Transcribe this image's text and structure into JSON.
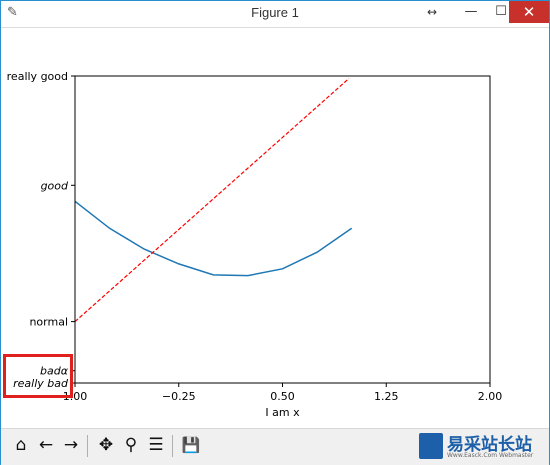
{
  "window": {
    "title": "Figure 1",
    "icon": "feather-icon",
    "buttons": {
      "resize": "↔",
      "minimize": "—",
      "maximize": "☐",
      "close": "✕"
    }
  },
  "toolbar": {
    "items": [
      {
        "name": "home-icon",
        "glyph": "⌂"
      },
      {
        "name": "back-arrow-icon",
        "glyph": "←"
      },
      {
        "name": "forward-arrow-icon",
        "glyph": "→"
      },
      {
        "name": "pan-icon",
        "glyph": "✥"
      },
      {
        "name": "zoom-icon",
        "glyph": "⚲"
      },
      {
        "name": "configure-subplots-icon",
        "glyph": "☰"
      },
      {
        "name": "save-icon",
        "glyph": "💾"
      }
    ]
  },
  "brand": {
    "name": "易采站长站",
    "url": "Www.Easck.Com Webmaster"
  },
  "chart_data": {
    "type": "line",
    "xlabel": "I am x",
    "xlim": [
      -1.0,
      2.0
    ],
    "ylim": [
      -2.0,
      3.0
    ],
    "xticks": [
      {
        "value": -1.0,
        "label": "1.00"
      },
      {
        "value": -0.25,
        "label": "−0.25"
      },
      {
        "value": 0.5,
        "label": "0.50"
      },
      {
        "value": 1.25,
        "label": "1.25"
      },
      {
        "value": 2.0,
        "label": "2.00"
      }
    ],
    "yticks": [
      {
        "value": -2.0,
        "label": "really bad",
        "style": "italic"
      },
      {
        "value": -1.8,
        "label": "badα",
        "style": "italic"
      },
      {
        "value": -1.0,
        "label": "normal",
        "style": "normal"
      },
      {
        "value": 1.22,
        "label": "good",
        "style": "italic"
      },
      {
        "value": 3.0,
        "label": "really good",
        "style": "normal"
      }
    ],
    "series": [
      {
        "style": "solid",
        "color": "#1f77b4",
        "x": [
          -1.0,
          -0.75,
          -0.5,
          -0.25,
          0.0,
          0.25,
          0.5,
          0.75,
          1.0
        ],
        "y": [
          0.96,
          0.52,
          0.18,
          -0.06,
          -0.24,
          -0.25,
          -0.14,
          0.13,
          0.52
        ]
      },
      {
        "style": "dashed",
        "color": "#ff0000",
        "x": [
          -1.0,
          0.98
        ],
        "y": [
          -1.0,
          2.96
        ]
      }
    ]
  }
}
